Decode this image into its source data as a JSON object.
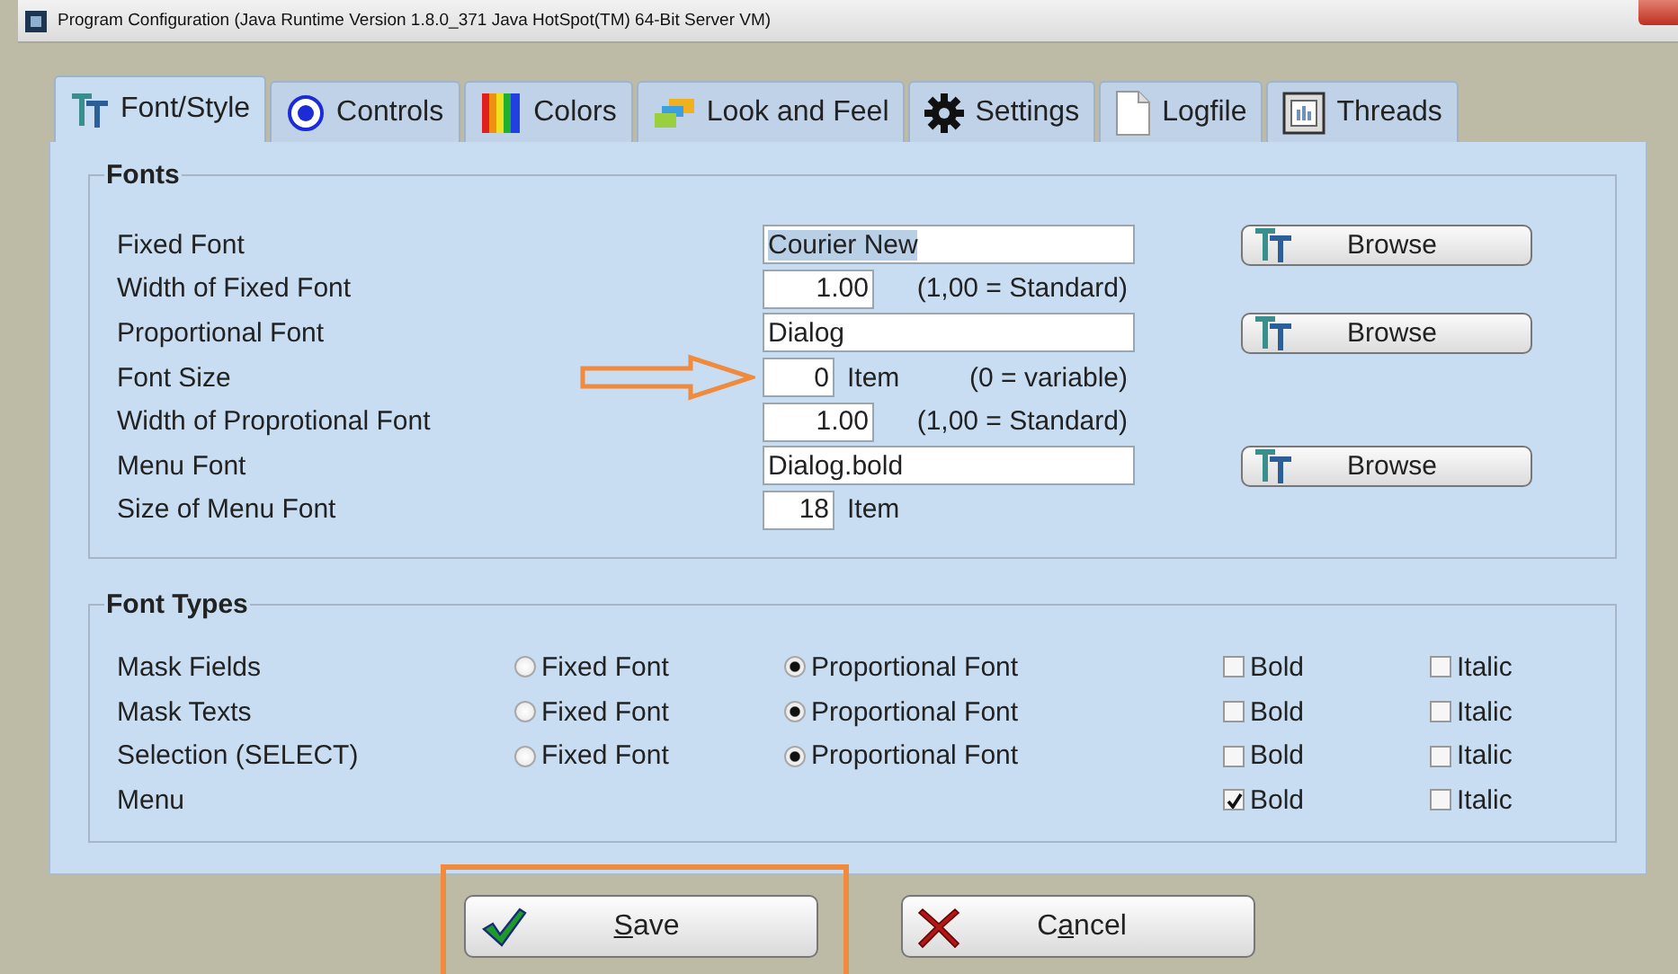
{
  "window": {
    "title": "Program Configuration (Java Runtime Version 1.8.0_371 Java HotSpot(TM) 64-Bit Server VM)"
  },
  "tabs": [
    {
      "label": "Font/Style",
      "selected": true
    },
    {
      "label": "Controls",
      "selected": false
    },
    {
      "label": "Colors",
      "selected": false
    },
    {
      "label": "Look and Feel",
      "selected": false
    },
    {
      "label": "Settings",
      "selected": false
    },
    {
      "label": "Logfile",
      "selected": false
    },
    {
      "label": "Threads",
      "selected": false
    }
  ],
  "fonts": {
    "title": "Fonts",
    "rows": [
      {
        "label": "Fixed Font",
        "kind": "text",
        "value": "Courier New",
        "text_selected": true,
        "pointed": false,
        "button": "Browse"
      },
      {
        "label": "Width of Fixed Font",
        "kind": "number",
        "value": "1.00",
        "text_selected": false,
        "pointed": false,
        "note": "(1,00 = Standard)"
      },
      {
        "label": "Proportional Font",
        "kind": "text",
        "value": "Dialog",
        "text_selected": false,
        "pointed": false,
        "button": "Browse"
      },
      {
        "label": "Font Size",
        "kind": "count",
        "value": "0",
        "unit": "Item",
        "text_selected": false,
        "pointed": true,
        "note": "(0 = variable)"
      },
      {
        "label": "Width of Proprotional Font",
        "kind": "number",
        "value": "1.00",
        "text_selected": false,
        "pointed": false,
        "note": "(1,00 = Standard)"
      },
      {
        "label": "Menu Font",
        "kind": "text",
        "value": "Dialog.bold",
        "text_selected": false,
        "pointed": false,
        "button": "Browse"
      },
      {
        "label": "Size of Menu Font",
        "kind": "count",
        "value": "18",
        "unit": "Item",
        "text_selected": false,
        "pointed": false
      }
    ]
  },
  "font_types": {
    "title": "Font Types",
    "rows": [
      {
        "label": "Mask Fields",
        "options": [
          {
            "label": "Fixed Font",
            "selected": false
          },
          {
            "label": "Proportional Font",
            "selected": true
          }
        ],
        "checks": [
          {
            "label": "Bold",
            "checked": false
          },
          {
            "label": "Italic",
            "checked": false
          }
        ]
      },
      {
        "label": "Mask Texts",
        "options": [
          {
            "label": "Fixed Font",
            "selected": false
          },
          {
            "label": "Proportional Font",
            "selected": true
          }
        ],
        "checks": [
          {
            "label": "Bold",
            "checked": false
          },
          {
            "label": "Italic",
            "checked": false
          }
        ]
      },
      {
        "label": "Selection (SELECT)",
        "options": [
          {
            "label": "Fixed Font",
            "selected": false
          },
          {
            "label": "Proportional Font",
            "selected": true
          }
        ],
        "checks": [
          {
            "label": "Bold",
            "checked": false
          },
          {
            "label": "Italic",
            "checked": false
          }
        ]
      },
      {
        "label": "Menu",
        "checks": [
          {
            "label": "Bold",
            "checked": true
          },
          {
            "label": "Italic",
            "checked": false
          }
        ]
      }
    ]
  },
  "buttons": [
    {
      "kind": "save",
      "key": "S",
      "after": "ave",
      "highlighted": true
    },
    {
      "kind": "cancel",
      "before": "C",
      "key": "a",
      "after": "ncel",
      "highlighted": false
    }
  ]
}
